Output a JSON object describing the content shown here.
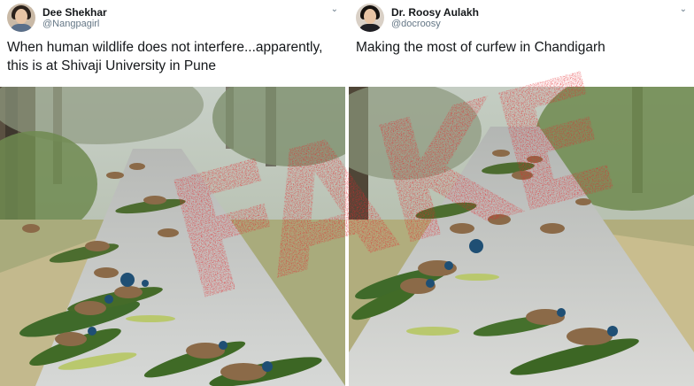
{
  "tweets": [
    {
      "display_name": "Dee Shekhar",
      "handle": "@Nangpagirl",
      "text": "When human wildlife does not interfere...apparently, this is at Shivaji University in Pune"
    },
    {
      "display_name": "Dr. Roosy Aulakh",
      "handle": "@docroosy",
      "text": "Making the most of curfew in Chandigarh"
    }
  ],
  "overlay": {
    "stamp_text": "FAKE",
    "stamp_color": "#e3262b"
  },
  "colors": {
    "name": "#14171a",
    "handle": "#657786"
  },
  "icons": {
    "menu": "chevron-down-icon"
  }
}
